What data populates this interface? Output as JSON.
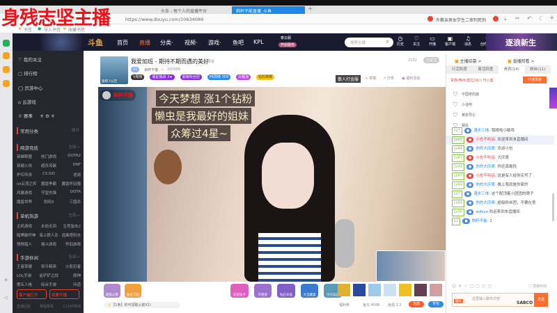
{
  "overlay_title": "身残志坚主播",
  "browser": {
    "tabs": [
      {
        "label": "头条 - 每个人的直播平台"
      },
      {
        "label": "斜杆不能直播_斗鱼"
      }
    ],
    "url": "https://www.douyu.com/10634089",
    "search_text": "外教亲男女学生二审判死刑",
    "bookmarks": [
      "书签",
      "导入书签",
      "收藏书签"
    ]
  },
  "header": {
    "logo": "斗鱼",
    "nav": [
      "首页",
      "直播",
      "分类·",
      "视频·",
      "游戏·",
      "鱼吧",
      "KPL"
    ],
    "cloud_label": "泰云服",
    "cloud_sub": "开启服务",
    "search_placeholder": "搜索主播",
    "icons": [
      "历史",
      "关注",
      "开播",
      "客户端",
      "消息",
      "创作中心"
    ],
    "banner": "逐浪新生"
  },
  "sidebar": {
    "items": [
      "我的关注",
      "排行榜",
      "页游中心",
      "云游戏",
      "赛事"
    ],
    "sections": [
      {
        "title": "常用分类",
        "more": "展开",
        "games": []
      },
      {
        "title": "网游竞技",
        "more": "全部→",
        "games": [
          "英雄联盟",
          "热门游戏",
          "DOTA2",
          "穿越火线",
          "超杀突破",
          "DNF",
          "炉石传说",
          "CS:GO",
          "逆战",
          "lol云顶之弈",
          "魔兽争霸",
          "魔兽怀旧服",
          "风暴游戏",
          "守望先锋",
          "DOTA",
          "魔兽世界",
          "剑网3",
          "三国杀"
        ]
      },
      {
        "title": "单机热游",
        "more": "全部→",
        "games": [
          "主机游戏",
          "永劫无间",
          "生死狙击2",
          "暗黑破坏神",
          "海上狼人杀",
          "逃离塔科夫",
          "怪物猎人",
          "格斗游戏",
          "怀旧游戏"
        ]
      },
      {
        "title": "手游休闲",
        "more": "全部→",
        "games": [
          "王者荣耀",
          "和平精英",
          "火影忍者",
          "LOL手游",
          "金铲铲之战",
          "原神",
          "第五人格",
          "综合手游",
          "问道"
        ]
      }
    ],
    "client_btn": "客户端打开",
    "stream_btn": "我要开播",
    "footer": [
      "直播回放",
      "赛程赛事",
      "12345热线"
    ]
  },
  "room": {
    "title": "我爱加班 - 期待不期而遇的美好",
    "report_tag": "举报",
    "streamer": "斜杆不能",
    "level": "11",
    "heat": "100988",
    "tags": [
      "V周榜",
      "福星挑战 3★",
      "超级粉丝团",
      "PK周榜 308",
      "白银泡",
      "钻石荣耀"
    ],
    "follow_count": "2152",
    "follow_btn": "已关注",
    "thumb_label": "鱼吧 1公告",
    "actions": [
      "散人打金服",
      "举报",
      "分享",
      "福利活动"
    ]
  },
  "video": {
    "streamer_tag": "斜杆不能",
    "subtitles": [
      "今天梦想 涨1个钻粉",
      "懒虫是我最好的姐妹",
      "众筹过4星~"
    ]
  },
  "gifts": {
    "left": [
      "超级火箭",
      "鱼丸飞船"
    ],
    "mid": [
      "花花仙子",
      "许愿星",
      "钻石水晶",
      "大宝藏盒",
      "冷冷兵兵"
    ],
    "notice": "【1条】你可领取火箭X1!",
    "fish_ball": "鱼丸 4588",
    "fish_fin": "鱼翅 2.2",
    "recharge": "充值",
    "bag": "背包",
    "welfare": "福利券"
  },
  "chat": {
    "top_links": [
      "主播招募 >",
      "直播回看 >"
    ],
    "tabs": [
      "日活跃度",
      "周活跃度",
      "贵宾(14)",
      "粉丝(11)"
    ],
    "vip_hint": "贵族/帝州/皇位/冰川 可入座",
    "open_btn": "开通贵族",
    "vip_list": [
      {
        "name": "中国老的面"
      },
      {
        "name": "小话唠"
      },
      {
        "name": "黄泉导仑"
      },
      {
        "name": "钢总"
      }
    ],
    "messages": [
      {
        "lv": "LV7",
        "nick": "漫步三体:",
        "text": "我晴啦小敏鸡",
        "red": false
      },
      {
        "lv": "LV47",
        "nick": "小也不听话:",
        "text": "欢迎来到本直播间",
        "red": true
      },
      {
        "lv": "LV44",
        "nick": "你的大庆哥:",
        "text": "欢迎小也",
        "red": false
      },
      {
        "lv": "LV47",
        "nick": "小也不听话:",
        "text": "大庆哥",
        "red": true
      },
      {
        "lv": "LV44",
        "nick": "你的大庆哥:",
        "text": "你还真敢找",
        "red": false
      },
      {
        "lv": "LV47",
        "nick": "小也不听话:",
        "text": "这是有人给你买号了",
        "red": true
      },
      {
        "lv": "LV44",
        "nick": "你的大庆哥:",
        "text": "晚上我就是你家的",
        "red": false
      },
      {
        "lv": "LV7",
        "nick": "漫步三体:",
        "text": "这个配顶着小团团的牌子",
        "red": false
      },
      {
        "lv": "LV44",
        "nick": "你的大庆哥:",
        "text": "超级粉丝团，不要在意",
        "red": false
      },
      {
        "lv": "LV30",
        "nick": "wdkye",
        "text": "欢迎来到本直播间",
        "red": false
      },
      {
        "lv": "11",
        "nick": "斜杆不能:",
        "text": "1",
        "red": false
      }
    ],
    "block_label": "屏蔽特效",
    "input_placeholder": "这里输入聊天内容",
    "send_btn": "发送",
    "gift_label": "送礼",
    "watermark": "SABCO ERK"
  }
}
